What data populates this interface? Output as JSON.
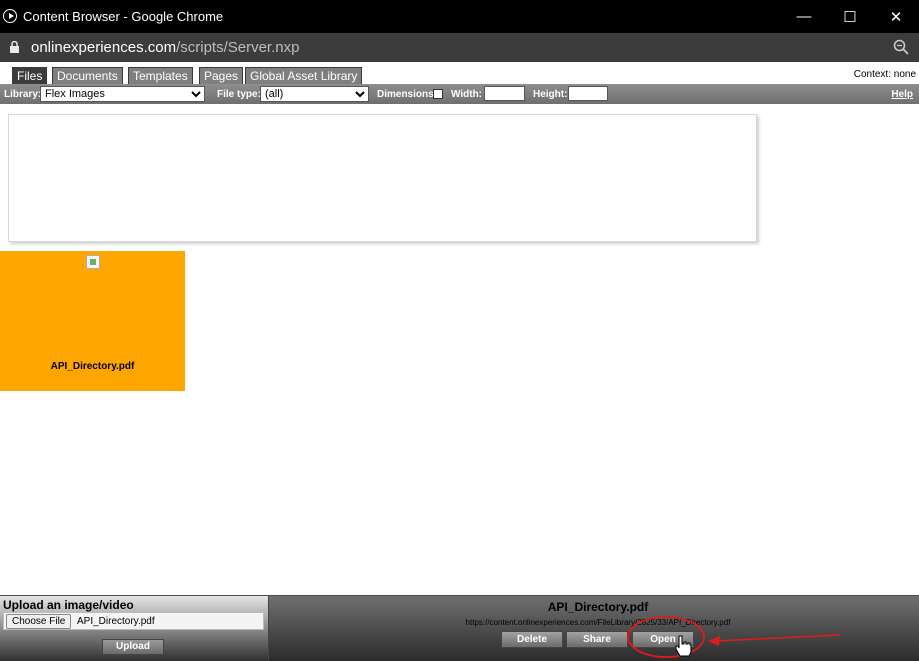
{
  "window": {
    "title": "Content Browser - Google Chrome",
    "minimize_glyph": "—",
    "maximize_glyph": "☐",
    "close_glyph": "✕"
  },
  "address": {
    "domain": "onlinexperiences.com",
    "path": "/scripts/Server.nxp"
  },
  "tabs": [
    {
      "label": "Files",
      "active": true
    },
    {
      "label": "Documents",
      "active": false
    },
    {
      "label": "Templates",
      "active": false
    },
    {
      "label": "Pages",
      "active": false
    },
    {
      "label": "Global Asset Library",
      "active": false
    }
  ],
  "context_label": "Context: none",
  "filters": {
    "library_label": "Library:",
    "library_value": "Flex Images",
    "filetype_label": "File type:",
    "filetype_value": "(all)",
    "dimensions_label": "Dimensions:",
    "width_label": "Width:",
    "height_label": "Height:",
    "help_label": "Help"
  },
  "files": [
    {
      "name": "API_Directory.pdf",
      "color": "#ffa500"
    }
  ],
  "upload": {
    "heading": "Upload an image/video",
    "choose_label": "Choose File",
    "chosen_file": "API_Directory.pdf",
    "upload_label": "Upload"
  },
  "detail": {
    "file_name": "API_Directory.pdf",
    "url": "https://content.onlinexperiences.com/FileLibrary/2825/33/API_Directory.pdf",
    "delete_label": "Delete",
    "share_label": "Share",
    "open_label": "Open"
  },
  "annotation": {
    "color": "#e01a1a",
    "highlight": "open-button"
  }
}
